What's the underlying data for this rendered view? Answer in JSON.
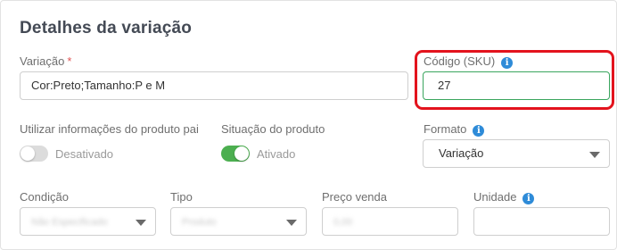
{
  "section": {
    "title": "Detalhes da variação"
  },
  "variacao": {
    "label": "Variação",
    "required_mark": "*",
    "value": "Cor:Preto;Tamanho:P e M"
  },
  "sku": {
    "label": "Código (SKU)",
    "value": "27",
    "info_glyph": "i"
  },
  "utilizar": {
    "label": "Utilizar informações do produto pai",
    "state": "Desativado"
  },
  "situacao": {
    "label": "Situação do produto",
    "state": "Ativado"
  },
  "formato": {
    "label": "Formato",
    "value": "Variação",
    "info_glyph": "i"
  },
  "condicao": {
    "label": "Condição",
    "value": "Não Especificado"
  },
  "tipo": {
    "label": "Tipo",
    "value": "Produto"
  },
  "preco": {
    "label": "Preço venda",
    "value": "0,00"
  },
  "unidade": {
    "label": "Unidade",
    "value": "",
    "info_glyph": "i"
  },
  "colors": {
    "accent_green": "#4caf50",
    "info_blue": "#2e8bd8",
    "highlight_red": "#e3131d"
  },
  "icons": [
    "info-icon",
    "chevron-down-icon"
  ]
}
